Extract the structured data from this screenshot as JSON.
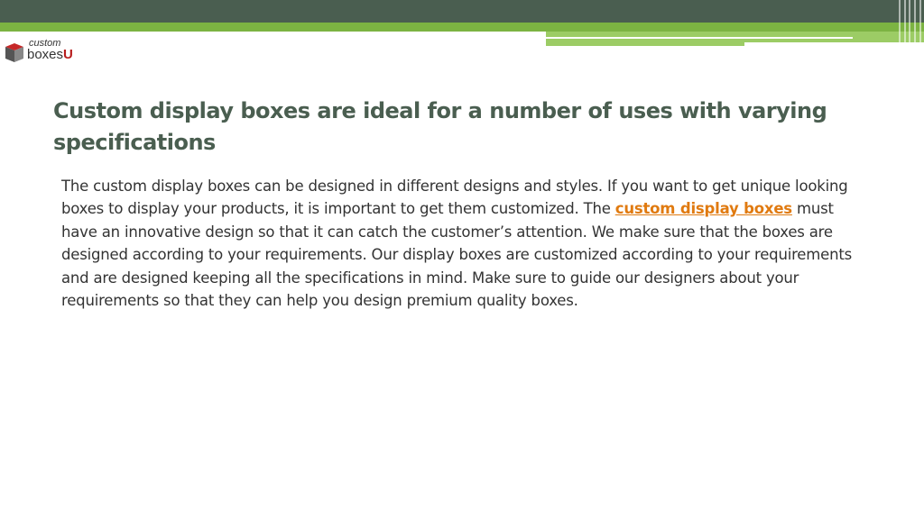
{
  "logo": {
    "word_top": "custom",
    "word_bottom": "boxes",
    "letter": "U"
  },
  "slide": {
    "title": "Custom display boxes are ideal for a number of uses with varying specifications",
    "body_before_link": "The custom display boxes can be designed in different designs and styles. If you want to get unique looking boxes to display your products, it is important to get them customized. The ",
    "link_text": "custom display boxes",
    "body_after_link": " must have an innovative design so that it can catch the customer’s attention. We make sure that the boxes are designed according to your requirements. Our display boxes are customized according to your requirements and are designed keeping all the specifications in mind. Make sure to guide our designers about your requirements so that they can help you design premium quality boxes."
  },
  "colors": {
    "header_dark": "#4a5e50",
    "header_green": "#7cb342",
    "title": "#4a5e50",
    "link": "#e07a10"
  }
}
